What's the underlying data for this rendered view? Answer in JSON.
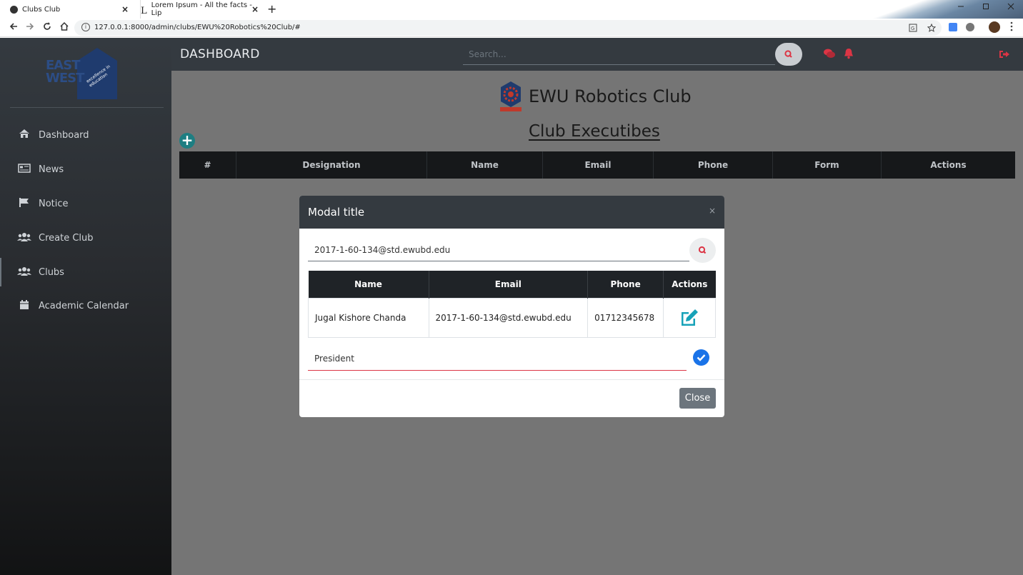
{
  "browser": {
    "tabs": [
      {
        "title": "Clubs Club"
      },
      {
        "title": "Lorem Ipsum - All the facts - Lip"
      }
    ],
    "tab_close_glyph": "×",
    "new_tab_glyph": "+",
    "url": "127.0.0.1:8000/admin/clubs/EWU%20Robotics%20Club/#"
  },
  "sidebar": {
    "logo_text_line1": "EAST",
    "logo_text_line2": "WEST",
    "logo_tagline": "excellence in education",
    "items": [
      {
        "label": "Dashboard",
        "icon": "home-icon"
      },
      {
        "label": "News",
        "icon": "newspaper-icon"
      },
      {
        "label": "Notice",
        "icon": "flag-icon"
      },
      {
        "label": "Create Club",
        "icon": "users-icon"
      },
      {
        "label": "Clubs",
        "icon": "users-icon"
      },
      {
        "label": "Academic Calendar",
        "icon": "calendar-icon"
      }
    ]
  },
  "topbar": {
    "title": "DASHBOARD",
    "search_placeholder": "Search..."
  },
  "main": {
    "club_name": "EWU Robotics Club",
    "section_title": "Club Executibes",
    "add_glyph": "+",
    "table_headers": [
      "#",
      "Designation",
      "Name",
      "Email",
      "Phone",
      "Form",
      "Actions"
    ]
  },
  "modal": {
    "title": "Modal title",
    "close_glyph": "×",
    "search_value": "2017-1-60-134@std.ewubd.edu",
    "table_headers": [
      "Name",
      "Email",
      "Phone",
      "Actions"
    ],
    "rows": [
      {
        "name": "Jugal Kishore Chanda",
        "email": "2017-1-60-134@std.ewubd.edu",
        "phone": "01712345678"
      }
    ],
    "designation_value": "President",
    "close_label": "Close"
  },
  "colors": {
    "accent_red": "#dc3545",
    "teal": "#17a2b8",
    "confirm_blue": "#1a73e8",
    "dark": "#343a40"
  }
}
